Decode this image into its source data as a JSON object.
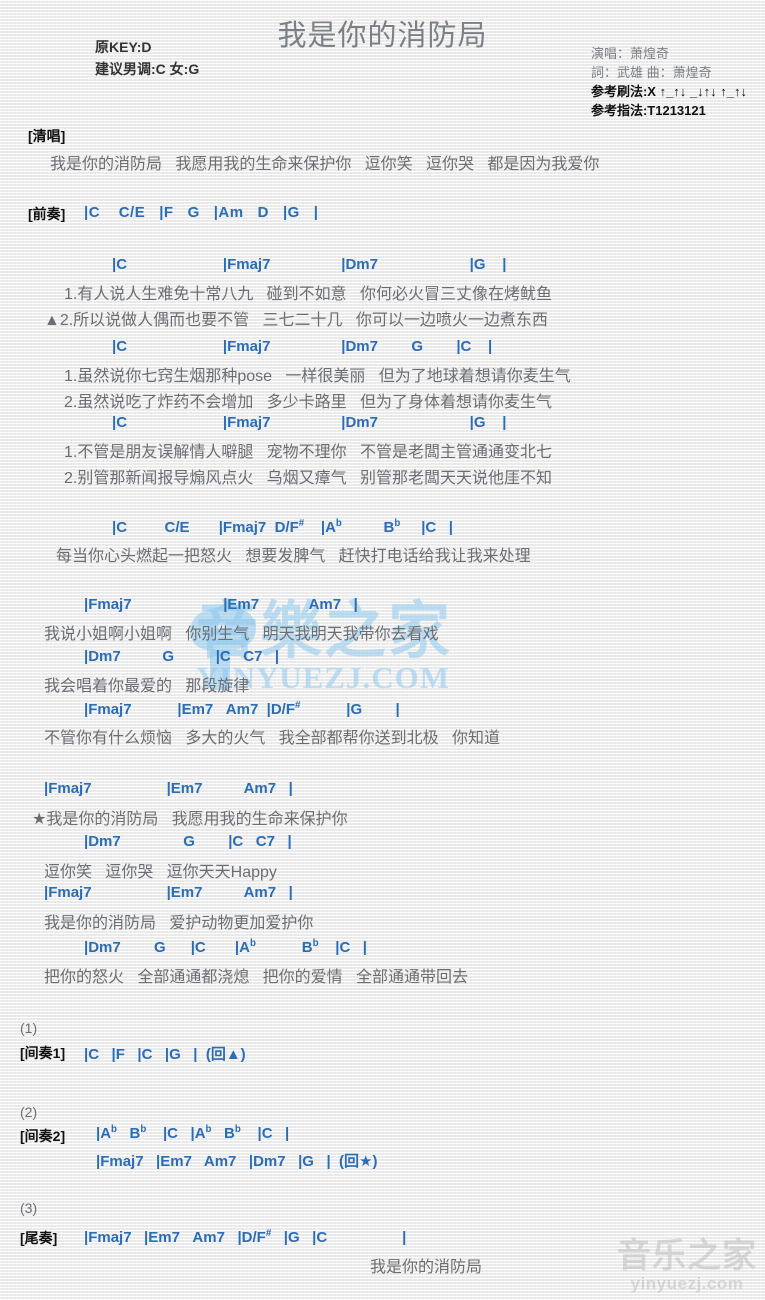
{
  "header": {
    "title": "我是你的消防局",
    "original_key": "原KEY:D",
    "suggested_key": "建议男调:C 女:G",
    "singer": "演唱：萧煌奇",
    "writers": "詞：武雄   曲：萧煌奇",
    "strum": "参考刷法:X ↑_↑↓ _↓↑↓ ↑_↑↓",
    "fingering": "参考指法:T1213121"
  },
  "sections": {
    "acappella_tag": "[清唱]",
    "acappella_lyric": "我是你的消防局   我愿用我的生命来保护你   逗你笑   逗你哭   都是因为我爱你",
    "intro_tag": "[前奏]",
    "intro_chords": "|C    C/E   |F   G   |Am   D   |G   |",
    "v1_chords": "|C                       |Fmaj7                 |Dm7                      |G    |",
    "v1_line1": "1.有人说人生难免十常八九   碰到不如意   你何必火冒三丈像在烤鱿鱼",
    "v1_line2": "▲2.所以说做人偶而也要不管   三七二十几   你可以一边喷火一边煮东西",
    "v2_chords": "|C                       |Fmaj7                 |Dm7        G        |C    |",
    "v2_line1": "1.虽然说你七窍生烟那种pose   一样很美丽   但为了地球着想请你麦生气",
    "v2_line2": "2.虽然说吃了炸药不会增加   多少卡路里   但为了身体着想请你麦生气",
    "v3_chords": "|C                       |Fmaj7                 |Dm7                      |G    |",
    "v3_line1": "1.不管是朋友误解情人噼腿   宠物不理你   不管是老闆主管通通变北七",
    "v3_line2": "2.别管那新闻报导煽风点火   乌烟又瘴气   别管那老闆天天说他厓不知",
    "pre_chords": "|C          C/E        |Fmaj7  D/F#      |Ab            Bb       |C   |",
    "pre_lyric": "每当你心头燃起一把怒火   想要发脾气   赶快打电话给我让我来处理",
    "b1_chords": "|Fmaj7                      |Em7            Am7   |",
    "b1_lyric": "我说小姐啊小姐啊   你别生气   明天我明天我带你去看戏",
    "b2_chords": "|Dm7          G          |C   C7   |",
    "b2_lyric": "我会唱着你最爱的   那段旋律",
    "b3_chords": "|Fmaj7           |Em7   Am7   |D/F#            |G        |",
    "b3_lyric": "不管你有什么烦恼   多大的火气   我全部都帮你送到北极   你知道",
    "c1_chords": "|Fmaj7                  |Em7          Am7   |",
    "c1_lyric": "★我是你的消防局   我愿用我的生命来保护你",
    "c2_chords": "|Dm7               G        |C   C7   |",
    "c2_lyric": "逗你笑   逗你哭   逗你天天Happy",
    "c3_chords": "|Fmaj7                  |Em7          Am7   |",
    "c3_lyric": "我是你的消防局   爱护动物更加爱护你",
    "c4_chords": "|Dm7        G       |C        |Ab            Bb      |C   |",
    "c4_lyric": "把你的怒火   全部通通都浇熄   把你的爱情   全部通通带回去",
    "num1": "(1)",
    "inter1_tag": "[间奏1]",
    "inter1_chords": "|C   |F   |C   |G   |  (回▲)",
    "num2": "(2)",
    "inter2_tag": "[间奏2]",
    "inter2_chords_a": "|Ab   Bb     |C    |Ab   Bb     |C   |",
    "inter2_chords_b": "|Fmaj7   |Em7   Am7   |Dm7   |G   |  (回★)",
    "num3": "(3)",
    "outro_tag": "[尾奏]",
    "outro_chords": "|Fmaj7   |Em7   Am7   |D/F#   |G   |C                        |",
    "outro_lyric": "我是你的消防局"
  },
  "watermark": {
    "center_cn": "音樂之家",
    "center_url": "YINYUEZJ.COM",
    "corner_cn": "音乐之家",
    "corner_url": "yinyuezj.com"
  },
  "colors": {
    "chord": "#2a6db5",
    "lyric": "#6a6e74",
    "title": "#7b7f86",
    "watermark_blue": "#8ec8ef"
  }
}
